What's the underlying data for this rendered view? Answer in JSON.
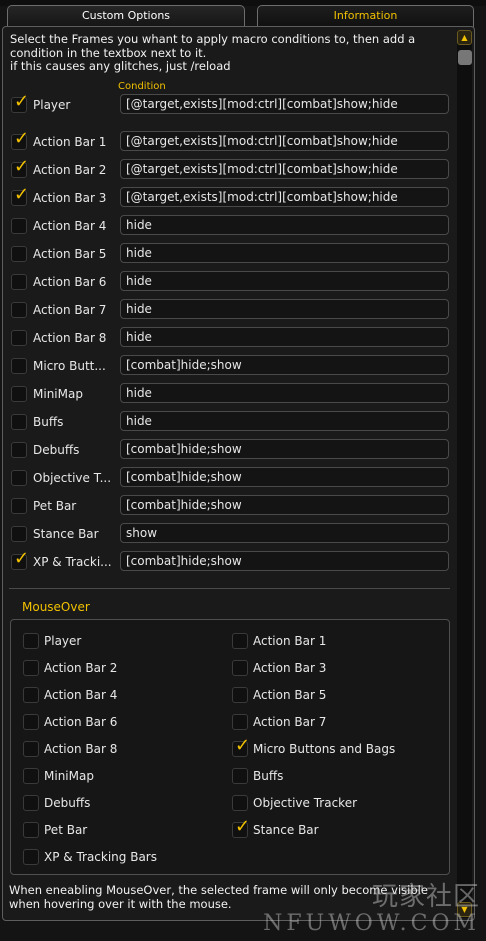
{
  "tabs": [
    {
      "label": "Custom Options",
      "active": true
    },
    {
      "label": "Information",
      "active": false
    }
  ],
  "intro": {
    "line1": "Select the Frames you whant to apply macro conditions to, then add a condition in the textbox next to it.",
    "line2": "if this causes any glitches, just /reload"
  },
  "condition_header": "Condition",
  "frames": [
    {
      "label": "Player",
      "checked": true,
      "condition": "[@target,exists][mod:ctrl][combat]show;hide"
    },
    {
      "label": "Action Bar 1",
      "checked": true,
      "condition": "[@target,exists][mod:ctrl][combat]show;hide"
    },
    {
      "label": "Action Bar 2",
      "checked": true,
      "condition": "[@target,exists][mod:ctrl][combat]show;hide"
    },
    {
      "label": "Action Bar 3",
      "checked": true,
      "condition": "[@target,exists][mod:ctrl][combat]show;hide"
    },
    {
      "label": "Action Bar 4",
      "checked": false,
      "condition": "hide"
    },
    {
      "label": "Action Bar 5",
      "checked": false,
      "condition": "hide"
    },
    {
      "label": "Action Bar 6",
      "checked": false,
      "condition": "hide"
    },
    {
      "label": "Action Bar 7",
      "checked": false,
      "condition": "hide"
    },
    {
      "label": "Action Bar 8",
      "checked": false,
      "condition": "hide"
    },
    {
      "label": "Micro Butt...",
      "checked": false,
      "condition": "[combat]hide;show"
    },
    {
      "label": "MiniMap",
      "checked": false,
      "condition": "hide"
    },
    {
      "label": "Buffs",
      "checked": false,
      "condition": "hide"
    },
    {
      "label": "Debuffs",
      "checked": false,
      "condition": "[combat]hide;show"
    },
    {
      "label": "Objective T...",
      "checked": false,
      "condition": "[combat]hide;show"
    },
    {
      "label": "Pet Bar",
      "checked": false,
      "condition": "[combat]hide;show"
    },
    {
      "label": "Stance Bar",
      "checked": false,
      "condition": "show"
    },
    {
      "label": "XP & Tracki...",
      "checked": true,
      "condition": "[combat]hide;show"
    }
  ],
  "mouseover": {
    "title": "MouseOver",
    "items": [
      {
        "label": "Player",
        "checked": false
      },
      {
        "label": "Action Bar 1",
        "checked": false
      },
      {
        "label": "Action Bar 2",
        "checked": false
      },
      {
        "label": "Action Bar 3",
        "checked": false
      },
      {
        "label": "Action Bar 4",
        "checked": false
      },
      {
        "label": "Action Bar 5",
        "checked": false
      },
      {
        "label": "Action Bar 6",
        "checked": false
      },
      {
        "label": "Action Bar 7",
        "checked": false
      },
      {
        "label": "Action Bar 8",
        "checked": false
      },
      {
        "label": "Micro Buttons and Bags",
        "checked": true
      },
      {
        "label": "MiniMap",
        "checked": false
      },
      {
        "label": "Buffs",
        "checked": false
      },
      {
        "label": "Debuffs",
        "checked": false
      },
      {
        "label": "Objective Tracker",
        "checked": false
      },
      {
        "label": "Pet Bar",
        "checked": false
      },
      {
        "label": "Stance Bar",
        "checked": true
      },
      {
        "label": "XP & Tracking Bars",
        "checked": false
      }
    ]
  },
  "footer": "When eneabling MouseOver, the selected frame will only become visible when hovering over it with the mouse.",
  "watermark": {
    "cn": "玩家社区",
    "en": "NFUWOW.COM"
  },
  "colors": {
    "accent": "#f0c000",
    "check": "#f2c200",
    "panel": "#1a1a1a",
    "border": "#5e5e5e"
  },
  "icons": {
    "check": "checkmark-icon",
    "scroll_up": "scroll-up-icon",
    "scroll_down": "scroll-down-icon"
  }
}
